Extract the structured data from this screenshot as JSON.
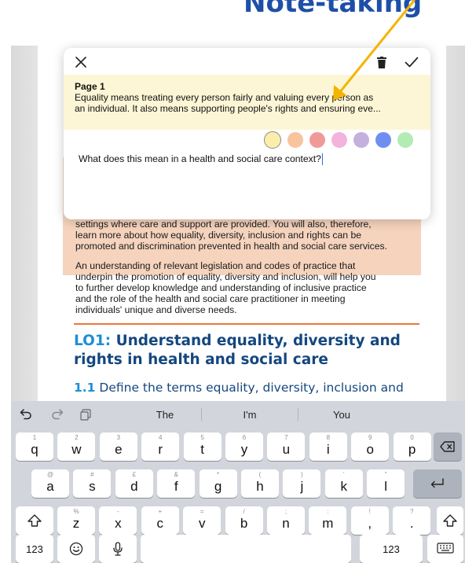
{
  "caption": {
    "text": "Note-taking"
  },
  "document": {
    "intro_paragraph_1": [
      "settings where care and support are provided. You will also, therefore,",
      "learn more about how equality, diversity, inclusion and rights can be",
      "promoted and discrimination prevented in health and social care services."
    ],
    "intro_paragraph_2": [
      "An understanding of relevant legislation and codes of practice that",
      "underpin the promotion of equality, diversity and inclusion, will help you",
      "to further develop knowledge and understanding of inclusive practice",
      "and the role of the health and social care practitioner in meeting",
      "individuals' unique and diverse needs."
    ],
    "lo_heading": {
      "code": "LO1:",
      "line1": "Understand equality, diversity and",
      "line2": "rights in health and social care"
    },
    "sub_heading": {
      "code": "1.1",
      "text": "Define the terms equality, diversity, inclusion and"
    }
  },
  "note_popup": {
    "close_icon": "close-icon",
    "trash_icon": "trash-icon",
    "done_icon": "checkmark-icon",
    "excerpt_title": "Page 1",
    "excerpt_line1": "Equality means treating every person fairly and valuing every person as",
    "excerpt_line2": "an individual. It also means supporting people's rights and ensuring eve...",
    "colors": [
      {
        "name": "yellow",
        "hex": "#fbeeaa",
        "selected": true
      },
      {
        "name": "orange",
        "hex": "#f8c49d",
        "selected": false
      },
      {
        "name": "red",
        "hex": "#f19999",
        "selected": false
      },
      {
        "name": "pink",
        "hex": "#f3b3dc",
        "selected": false
      },
      {
        "name": "purple",
        "hex": "#c3b0de",
        "selected": false
      },
      {
        "name": "blue",
        "hex": "#6f8ff0",
        "selected": false
      },
      {
        "name": "green",
        "hex": "#b2ecb2",
        "selected": false
      }
    ],
    "note_text": "What does this mean in a health and social care context?"
  },
  "keyboard": {
    "suggestions": [
      "The",
      "I'm",
      "You"
    ],
    "row1": [
      {
        "hint": "1",
        "key": "q"
      },
      {
        "hint": "2",
        "key": "w"
      },
      {
        "hint": "3",
        "key": "e"
      },
      {
        "hint": "4",
        "key": "r"
      },
      {
        "hint": "5",
        "key": "t"
      },
      {
        "hint": "6",
        "key": "y"
      },
      {
        "hint": "7",
        "key": "u"
      },
      {
        "hint": "8",
        "key": "i"
      },
      {
        "hint": "9",
        "key": "o"
      },
      {
        "hint": "0",
        "key": "p"
      }
    ],
    "row2": [
      {
        "hint": "@",
        "key": "a"
      },
      {
        "hint": "#",
        "key": "s"
      },
      {
        "hint": "£",
        "key": "d"
      },
      {
        "hint": "&",
        "key": "f"
      },
      {
        "hint": "*",
        "key": "g"
      },
      {
        "hint": "(",
        "key": "h"
      },
      {
        "hint": ")",
        "key": "j"
      },
      {
        "hint": "'",
        "key": "k"
      },
      {
        "hint": "\"",
        "key": "l"
      }
    ],
    "row3": [
      {
        "hint": "%",
        "key": "z"
      },
      {
        "hint": "-",
        "key": "x"
      },
      {
        "hint": "+",
        "key": "c"
      },
      {
        "hint": "=",
        "key": "v"
      },
      {
        "hint": "/",
        "key": "b"
      },
      {
        "hint": ";",
        "key": "n"
      },
      {
        "hint": ":",
        "key": "m"
      },
      {
        "hint": "",
        "key": "!\n,"
      },
      {
        "hint": "",
        "key": "?\n."
      }
    ],
    "numbers_label": "123",
    "icons": [
      "undo-icon",
      "redo-icon",
      "clipboard-icon",
      "backspace-icon",
      "return-icon",
      "shift-icon",
      "emoji-icon",
      "microphone-icon",
      "keyboard-hide-icon"
    ]
  },
  "colors": {
    "caption": "#1e4fa8",
    "arrow": "#f4b400",
    "heading": "#14477f",
    "heading_code": "#1d8fd6",
    "intro_box": "#f5d3bd",
    "excerpt_bg": "#fdf6d6",
    "keyboard_bg": "#d2d5db"
  }
}
